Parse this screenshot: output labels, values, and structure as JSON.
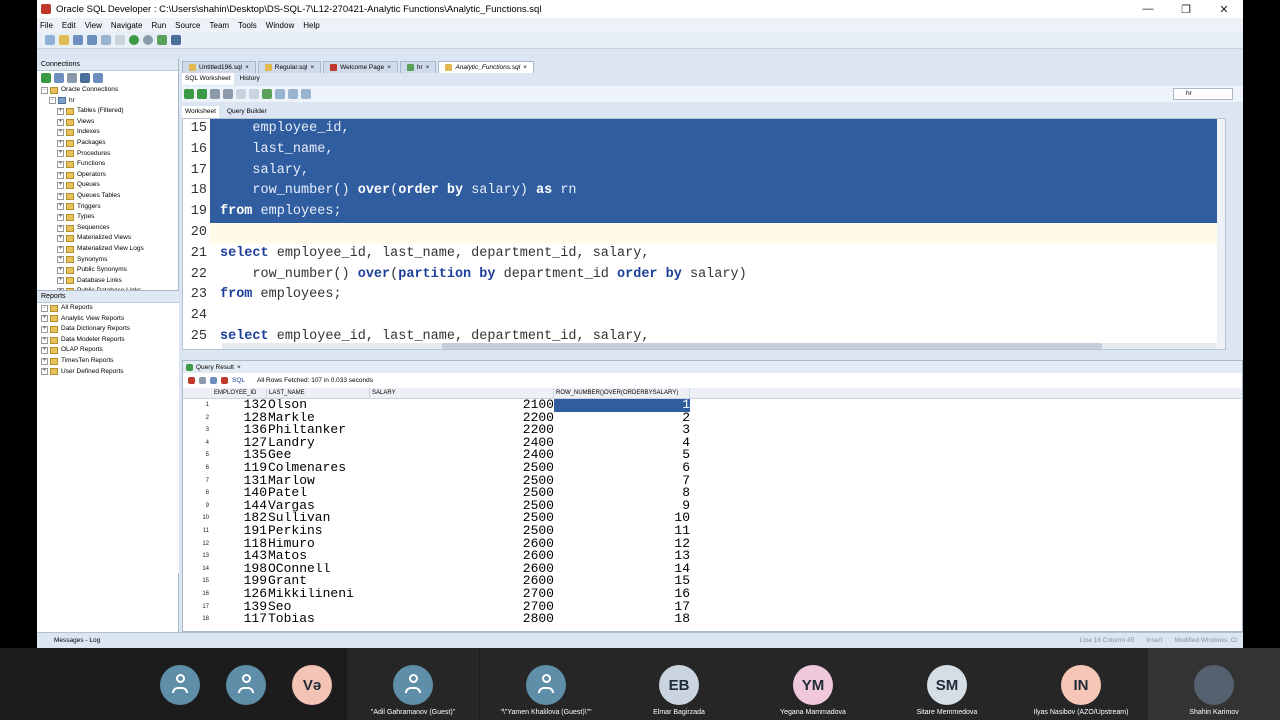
{
  "window": {
    "title": "Oracle SQL Developer : C:\\Users\\shahin\\Desktop\\DS-SQL-7\\L12-270421-Analytic Functions\\Analytic_Functions.sql",
    "controls": [
      "—",
      "❐",
      "✕"
    ]
  },
  "menu": [
    "File",
    "Edit",
    "View",
    "Navigate",
    "Run",
    "Source",
    "Team",
    "Tools",
    "Window",
    "Help"
  ],
  "connections": {
    "header": "Connections",
    "root": "Oracle Connections",
    "conn": "hr",
    "items": [
      "Tables (Filtered)",
      "Views",
      "Indexes",
      "Packages",
      "Procedures",
      "Functions",
      "Operators",
      "Queues",
      "Queues Tables",
      "Triggers",
      "Types",
      "Sequences",
      "Materialized Views",
      "Materialized View Logs",
      "Synonyms",
      "Public Synonyms",
      "Database Links",
      "Public Database Links",
      "Directories",
      "Editions",
      "XML Schemas"
    ]
  },
  "reports": {
    "header": "Reports",
    "root": "All Reports",
    "items": [
      "Analytic View Reports",
      "Data Dictionary Reports",
      "Data Modeler Reports",
      "OLAP Reports",
      "TimesTen Reports",
      "User Defined Reports"
    ]
  },
  "doc_tabs": [
    "Untitled196.sql",
    "Regular.sql",
    "Welcome Page",
    "hr",
    "Analytic_Functions.sql"
  ],
  "sub_tabs": [
    "SQL Worksheet",
    "History"
  ],
  "ws_tabs": [
    "Worksheet",
    "Query Builder"
  ],
  "connection_select": "hr",
  "editor": {
    "lines": [
      {
        "n": "15",
        "text": "    employee_id,",
        "sel": true
      },
      {
        "n": "16",
        "text": "    last_name,",
        "sel": true
      },
      {
        "n": "17",
        "text": "    salary,",
        "sel": true
      },
      {
        "n": "18",
        "text": "    row_number() over(order by salary) as rn",
        "sel": true
      },
      {
        "n": "19",
        "text": "from employees;",
        "sel": true
      },
      {
        "n": "20",
        "text": "",
        "cur": true
      },
      {
        "n": "21",
        "text": "select employee_id, last_name, department_id, salary,"
      },
      {
        "n": "22",
        "text": "    row_number() over(partition by department_id order by salary)"
      },
      {
        "n": "23",
        "text": "from employees;"
      },
      {
        "n": "24",
        "text": ""
      },
      {
        "n": "25",
        "text": "select employee_id, last_name, department_id, salary,"
      }
    ]
  },
  "results": {
    "tab": "Query Result",
    "sql_label": "SQL",
    "fetched": "All Rows Fetched: 107 in 0.033 seconds",
    "columns": [
      "EMPLOYEE_ID",
      "LAST_NAME",
      "SALARY",
      "ROW_NUMBER()OVER(ORDERBYSALARY)"
    ],
    "rows": [
      [
        "1",
        "132",
        "Olson",
        "2100",
        "1"
      ],
      [
        "2",
        "128",
        "Markle",
        "2200",
        "2"
      ],
      [
        "3",
        "136",
        "Philtanker",
        "2200",
        "3"
      ],
      [
        "4",
        "127",
        "Landry",
        "2400",
        "4"
      ],
      [
        "5",
        "135",
        "Gee",
        "2400",
        "5"
      ],
      [
        "6",
        "119",
        "Colmenares",
        "2500",
        "6"
      ],
      [
        "7",
        "131",
        "Marlow",
        "2500",
        "7"
      ],
      [
        "8",
        "140",
        "Patel",
        "2500",
        "8"
      ],
      [
        "9",
        "144",
        "Vargas",
        "2500",
        "9"
      ],
      [
        "10",
        "182",
        "Sullivan",
        "2500",
        "10"
      ],
      [
        "11",
        "191",
        "Perkins",
        "2500",
        "11"
      ],
      [
        "12",
        "118",
        "Himuro",
        "2600",
        "12"
      ],
      [
        "13",
        "143",
        "Matos",
        "2600",
        "13"
      ],
      [
        "14",
        "198",
        "OConnell",
        "2600",
        "14"
      ],
      [
        "15",
        "199",
        "Grant",
        "2600",
        "15"
      ],
      [
        "16",
        "126",
        "Mikkilineni",
        "2700",
        "16"
      ],
      [
        "17",
        "139",
        "Seo",
        "2700",
        "17"
      ],
      [
        "18",
        "117",
        "Tobias",
        "2800",
        "18"
      ]
    ]
  },
  "status": {
    "messages": "Messages - Log",
    "position": "Line 18 Column 45",
    "mode": "Insert",
    "modified": "Modified",
    "platform": "Windows: Cl"
  },
  "participants": [
    {
      "initials": "",
      "name": ""
    },
    {
      "initials": "",
      "name": ""
    },
    {
      "initials": "Və",
      "name": ""
    },
    {
      "initials": "",
      "name": "\"Adil Gahramanov (Guest)\""
    },
    {
      "initials": "",
      "name": "\"\\\"Yamen Khalilova (Guest)\\\"\""
    },
    {
      "initials": "EB",
      "name": "Elmar Bagirzada"
    },
    {
      "initials": "YM",
      "name": "Yegana Mammadova"
    },
    {
      "initials": "SM",
      "name": "Sitare Memmedova"
    },
    {
      "initials": "IN",
      "name": "Ilyas Nasibov (AZO/Upstream)"
    },
    {
      "initials": "",
      "name": "Shahin Karimov"
    }
  ],
  "colors": {
    "selection": "#2f5d9f",
    "keyword": "#1d3f99",
    "chrome": "#dce6f2"
  }
}
